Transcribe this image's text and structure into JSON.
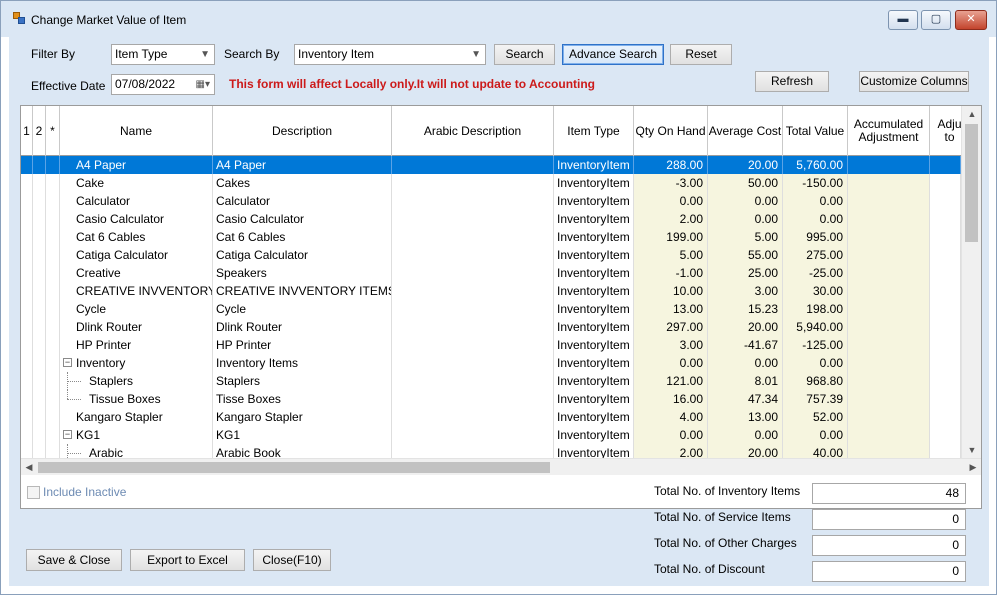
{
  "window": {
    "title": "Change Market Value of Item",
    "min_glyph": "▬",
    "max_glyph": "▢",
    "close_glyph": "✕"
  },
  "filters": {
    "filter_by_label": "Filter By",
    "filter_by_value": "Item Type",
    "search_by_label": "Search By",
    "search_by_value": "Inventory Item",
    "effective_date_label": "Effective Date",
    "effective_date_value": "07/08/2022",
    "warning": "This form will affect Locally only.It will not update to Accounting"
  },
  "buttons": {
    "search": "Search",
    "advance_search": "Advance Search",
    "reset": "Reset",
    "refresh": "Refresh",
    "customize_columns": "Customize Columns",
    "save_close": "Save & Close",
    "export_excel": "Export to Excel",
    "close": "Close(F10)"
  },
  "grid": {
    "columns": {
      "c1": "1",
      "c2": "2",
      "c3": "*",
      "name": "Name",
      "description": "Description",
      "arabic": "Arabic Description",
      "item_type": "Item Type",
      "qty": "Qty On Hand",
      "avg_cost": "Average Cost",
      "total_value": "Total Value",
      "accum_adj": "Accumulated Adjustment",
      "adj_to": "Adju to"
    },
    "rows": [
      {
        "name": "A4 Paper",
        "description": "A4 Paper",
        "arabic": "",
        "item_type": "InventoryItem",
        "qty": "288.00",
        "avg_cost": "20.00",
        "total_value": "5,760.00",
        "selected": true
      },
      {
        "name": "Cake",
        "description": "Cakes",
        "arabic": "",
        "item_type": "InventoryItem",
        "qty": "-3.00",
        "avg_cost": "50.00",
        "total_value": "-150.00"
      },
      {
        "name": "Calculator",
        "description": "Calculator",
        "arabic": "",
        "item_type": "InventoryItem",
        "qty": "0.00",
        "avg_cost": "0.00",
        "total_value": "0.00"
      },
      {
        "name": "Casio Calculator",
        "description": "Casio Calculator",
        "arabic": "",
        "item_type": "InventoryItem",
        "qty": "2.00",
        "avg_cost": "0.00",
        "total_value": "0.00"
      },
      {
        "name": "Cat 6 Cables",
        "description": "Cat 6 Cables",
        "arabic": "",
        "item_type": "InventoryItem",
        "qty": "199.00",
        "avg_cost": "5.00",
        "total_value": "995.00"
      },
      {
        "name": "Catiga Calculator",
        "description": "Catiga Calculator",
        "arabic": "",
        "item_type": "InventoryItem",
        "qty": "5.00",
        "avg_cost": "55.00",
        "total_value": "275.00"
      },
      {
        "name": "Creative",
        "description": "Speakers",
        "arabic": "",
        "item_type": "InventoryItem",
        "qty": "-1.00",
        "avg_cost": "25.00",
        "total_value": "-25.00"
      },
      {
        "name": "CREATIVE INVVENTORY ITEMS",
        "description": "CREATIVE INVVENTORY ITEMS",
        "arabic": "",
        "item_type": "InventoryItem",
        "qty": "10.00",
        "avg_cost": "3.00",
        "total_value": "30.00"
      },
      {
        "name": "Cycle",
        "description": "Cycle",
        "arabic": "",
        "item_type": "InventoryItem",
        "qty": "13.00",
        "avg_cost": "15.23",
        "total_value": "198.00"
      },
      {
        "name": "Dlink Router",
        "description": "Dlink Router",
        "arabic": "",
        "item_type": "InventoryItem",
        "qty": "297.00",
        "avg_cost": "20.00",
        "total_value": "5,940.00"
      },
      {
        "name": "HP Printer",
        "description": "HP Printer",
        "arabic": "",
        "item_type": "InventoryItem",
        "qty": "3.00",
        "avg_cost": "-41.67",
        "total_value": "-125.00"
      },
      {
        "name": "Inventory",
        "description": "Inventory Items",
        "arabic": "",
        "item_type": "InventoryItem",
        "qty": "0.00",
        "avg_cost": "0.00",
        "total_value": "0.00",
        "parent": true,
        "toggle": "−"
      },
      {
        "name": "Staplers",
        "description": "Staplers",
        "arabic": "",
        "item_type": "InventoryItem",
        "qty": "121.00",
        "avg_cost": "8.01",
        "total_value": "968.80",
        "child": true
      },
      {
        "name": "Tissue Boxes",
        "description": "Tisse Boxes",
        "arabic": "",
        "item_type": "InventoryItem",
        "qty": "16.00",
        "avg_cost": "47.34",
        "total_value": "757.39",
        "child": true,
        "last_child": true
      },
      {
        "name": "Kangaro Stapler",
        "description": "Kangaro Stapler",
        "arabic": "",
        "item_type": "InventoryItem",
        "qty": "4.00",
        "avg_cost": "13.00",
        "total_value": "52.00"
      },
      {
        "name": "KG1",
        "description": "KG1",
        "arabic": "",
        "item_type": "InventoryItem",
        "qty": "0.00",
        "avg_cost": "0.00",
        "total_value": "0.00",
        "parent": true,
        "toggle": "−"
      },
      {
        "name": "Arabic",
        "description": "Arabic Book",
        "arabic": "",
        "item_type": "InventoryItem",
        "qty": "2.00",
        "avg_cost": "20.00",
        "total_value": "40.00",
        "child": true
      }
    ]
  },
  "footer": {
    "include_inactive": "Include Inactive",
    "totals": [
      {
        "label": "Total No. of Inventory Items",
        "value": "48"
      },
      {
        "label": "Total No. of Service Items",
        "value": "0"
      },
      {
        "label": "Total No. of Other Charges",
        "value": "0"
      },
      {
        "label": "Total No. of Discount",
        "value": "0"
      }
    ]
  },
  "colors": {
    "selection": "#0078d7",
    "warning": "#cc1a1a",
    "numeric_column_bg": "#f6f5df"
  }
}
